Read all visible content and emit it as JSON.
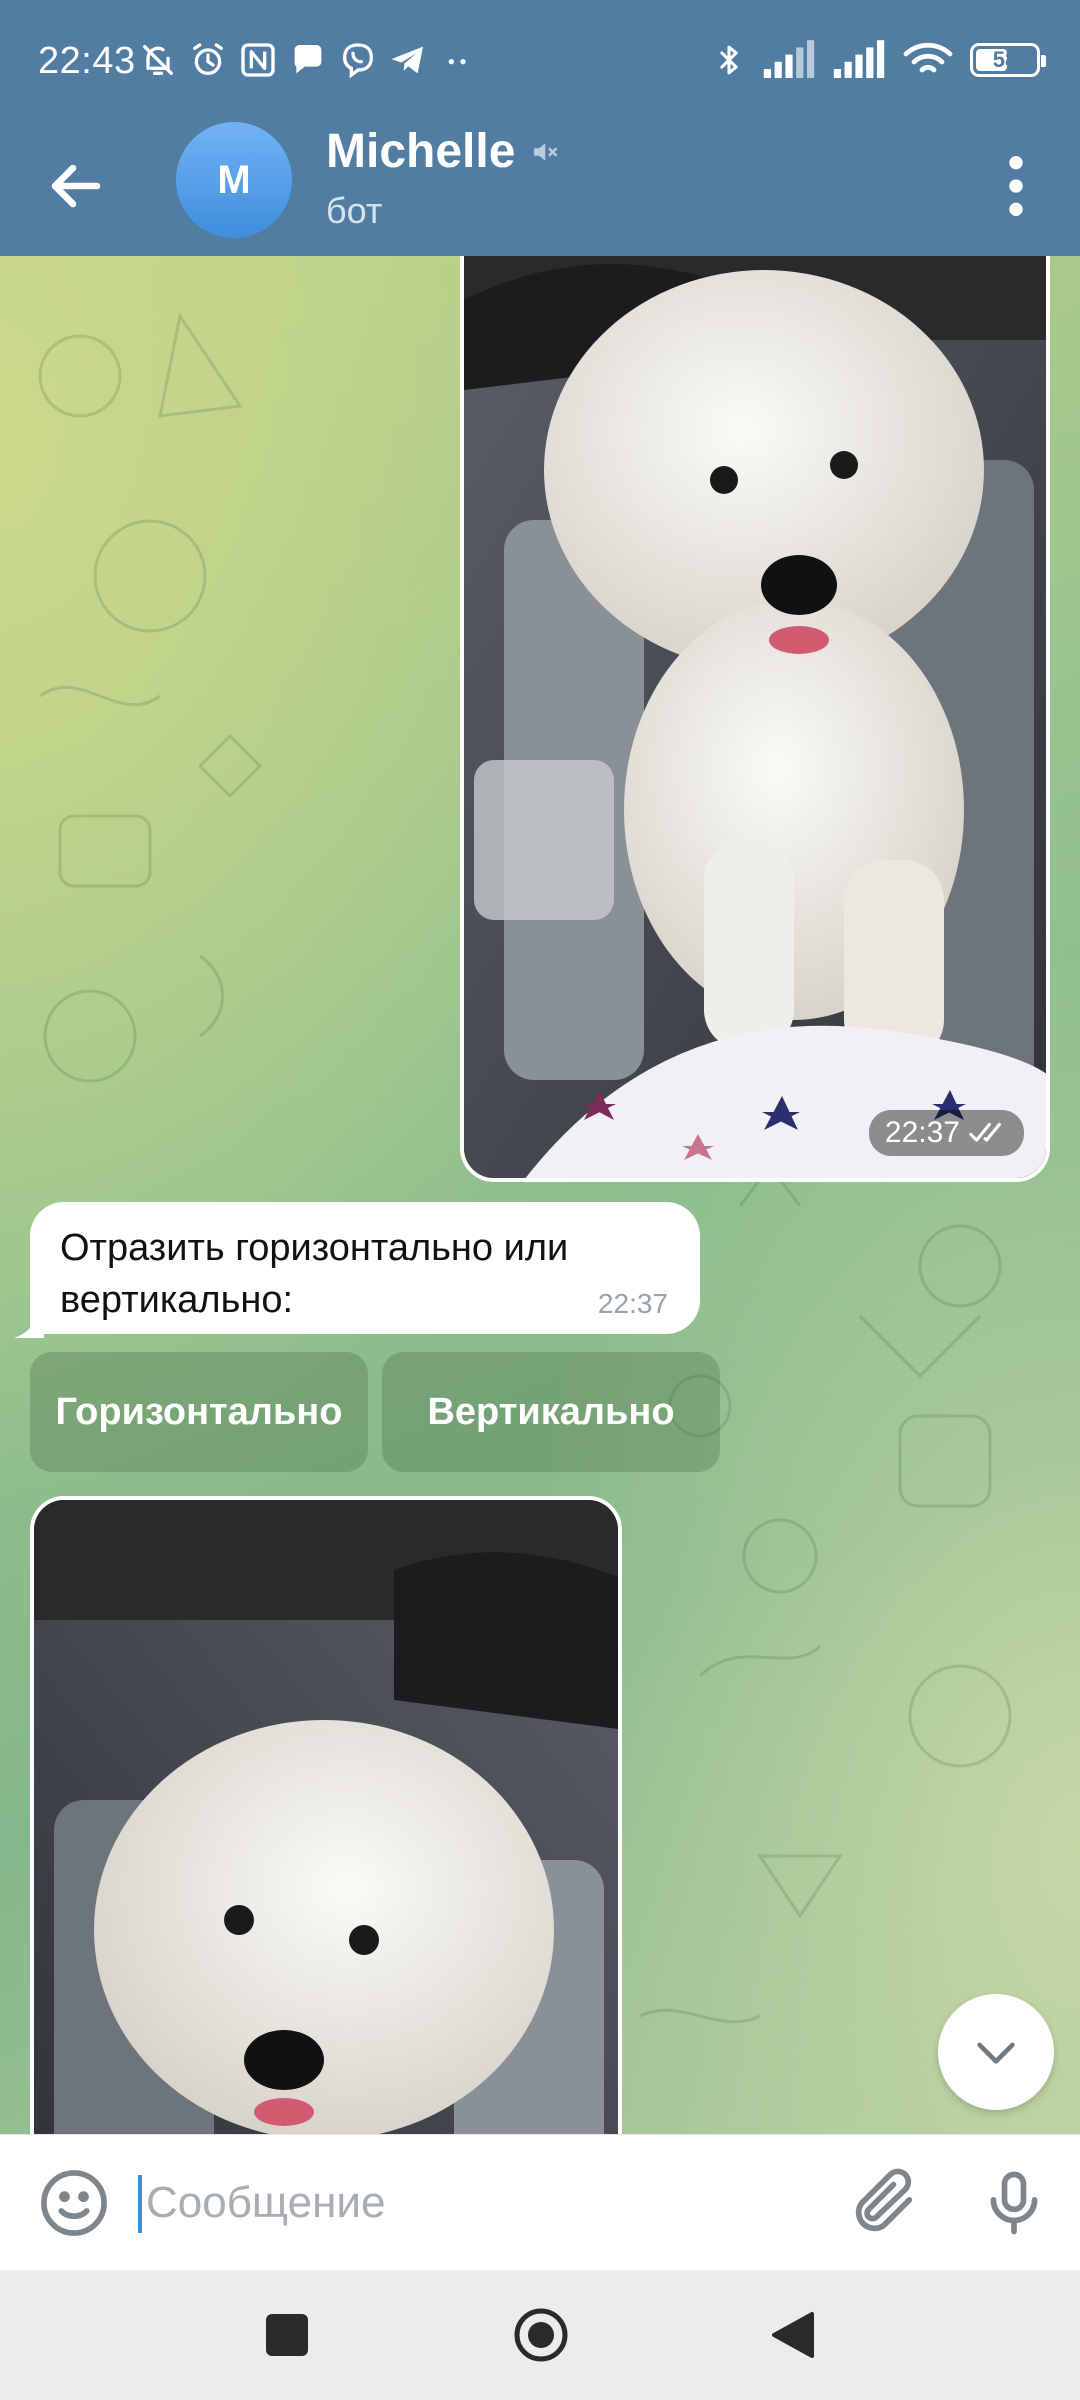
{
  "status_bar": {
    "time": "22:43",
    "left_icons": [
      "mute-bell-icon",
      "alarm-icon",
      "nfc-icon",
      "chat-bubble-icon",
      "viber-icon",
      "telegram-icon",
      "more-dots-icon"
    ],
    "right_icons": [
      "bluetooth-icon",
      "signal-icon",
      "signal-icon",
      "wifi-icon"
    ],
    "battery": "58",
    "battery_level": 0.58
  },
  "header": {
    "back_icon": "arrow-left-icon",
    "avatar_letter": "M",
    "title": "Michelle",
    "muted_icon": "muted-speaker-icon",
    "subtitle": "бот",
    "menu_icon": "vertical-dots-icon"
  },
  "messages": {
    "photo_out": {
      "time": "22:37",
      "read_icon": "double-check-icon"
    },
    "text_in": {
      "text": "Отразить горизонтально или вертикально:",
      "time": "22:37"
    },
    "keyboard": [
      {
        "label": "Горизонтально"
      },
      {
        "label": "Вертикально"
      }
    ]
  },
  "scroll_down_icon": "chevron-down-icon",
  "input": {
    "placeholder": "Сообщение",
    "value": "",
    "emoji_icon": "emoji-icon",
    "attach_icon": "paperclip-icon",
    "mic_icon": "microphone-icon"
  },
  "nav": {
    "recents_icon": "square-icon",
    "home_icon": "circle-icon",
    "back_icon": "triangle-back-icon"
  },
  "colors": {
    "header_bg": "#517da2",
    "accent": "#3b8fd7",
    "bubble_in": "#ffffff"
  }
}
